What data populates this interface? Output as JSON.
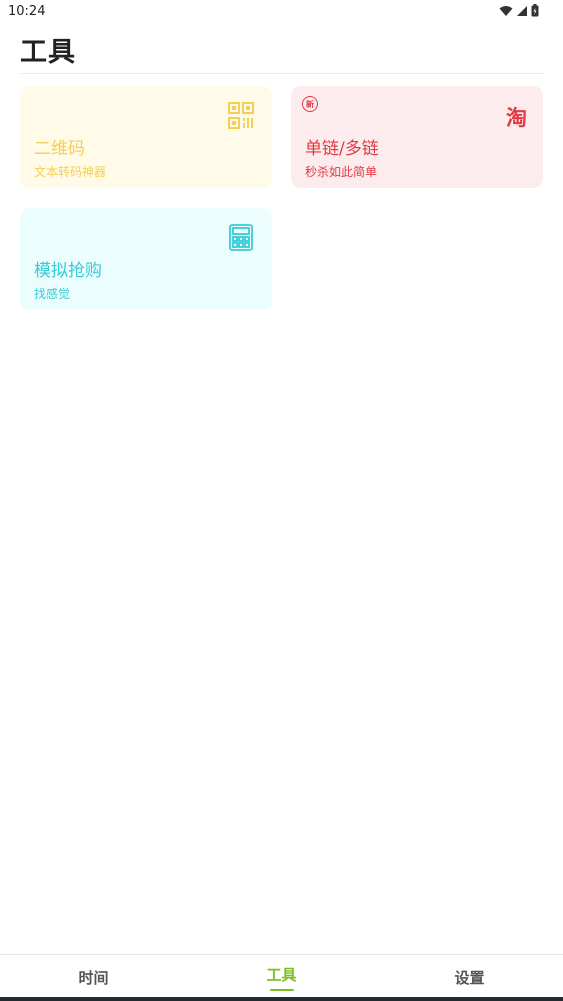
{
  "status_bar": {
    "time": "10:24",
    "icons": [
      "wifi-icon",
      "signal-icon",
      "battery-icon"
    ]
  },
  "page": {
    "title": "工具"
  },
  "cards": [
    {
      "title": "二维码",
      "subtitle": "文本转码神器",
      "icon": "qr-code-icon",
      "color": "#f4cf55",
      "background": "#fffbe8"
    },
    {
      "title": "单链/多链",
      "subtitle": "秒杀如此简单",
      "badge": "新",
      "icon_text": "淘",
      "icon": "taobao-icon",
      "color": "#e23a44",
      "background": "#fdeced"
    },
    {
      "title": "模拟抢购",
      "subtitle": "找感觉",
      "icon": "calculator-icon",
      "color": "#37ccd6",
      "background": "#ecfdfe"
    }
  ],
  "bottom_nav": {
    "items": [
      {
        "label": "时间",
        "active": false
      },
      {
        "label": "工具",
        "active": true
      },
      {
        "label": "设置",
        "active": false
      }
    ],
    "active_color": "#7ac11d"
  }
}
